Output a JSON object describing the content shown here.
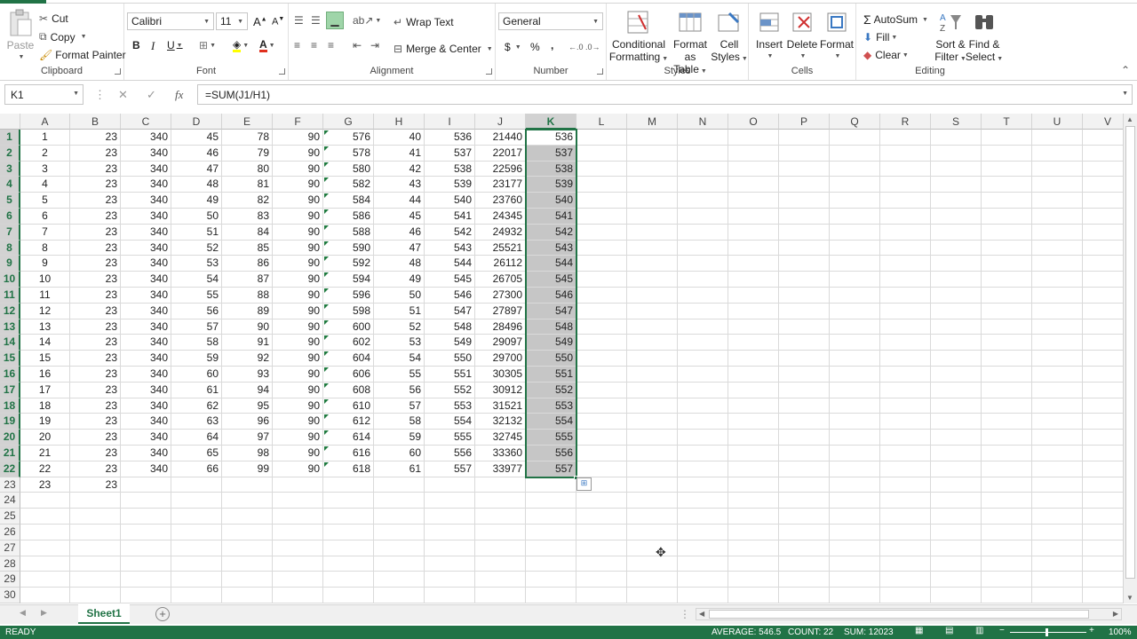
{
  "clipboard": {
    "paste": "Paste",
    "cut": "Cut",
    "copy": "Copy",
    "format_painter": "Format Painter",
    "label": "Clipboard"
  },
  "font": {
    "name": "Calibri",
    "size": "11",
    "label": "Font",
    "bold": "B",
    "italic": "I",
    "underline": "U"
  },
  "alignment": {
    "wrap": "Wrap Text",
    "merge": "Merge & Center",
    "label": "Alignment"
  },
  "number": {
    "format": "General",
    "currency": "$",
    "percent": "%",
    "comma": ",",
    "label": "Number"
  },
  "styles": {
    "conditional_1": "Conditional",
    "conditional_2": "Formatting",
    "table_1": "Format as",
    "table_2": "Table",
    "cell_1": "Cell",
    "cell_2": "Styles",
    "label": "Styles"
  },
  "cells": {
    "insert": "Insert",
    "delete": "Delete",
    "format": "Format",
    "label": "Cells"
  },
  "editing": {
    "autosum": "AutoSum",
    "fill": "Fill",
    "clear": "Clear",
    "sort_1": "Sort &",
    "sort_2": "Filter",
    "find_1": "Find &",
    "find_2": "Select",
    "label": "Editing"
  },
  "formula_bar": {
    "name_box": "K1",
    "fx": "fx",
    "formula": "=SUM(J1/H1)"
  },
  "grid": {
    "columns": [
      "A",
      "B",
      "C",
      "D",
      "E",
      "F",
      "G",
      "H",
      "I",
      "J",
      "K",
      "L",
      "M",
      "N",
      "O",
      "P",
      "Q",
      "R",
      "S",
      "T",
      "U",
      "V"
    ],
    "selected_column": "K",
    "rows": [
      [
        "1",
        "23",
        "340",
        "45",
        "78",
        "90",
        "576",
        "40",
        "536",
        "21440",
        "536"
      ],
      [
        "2",
        "23",
        "340",
        "46",
        "79",
        "90",
        "578",
        "41",
        "537",
        "22017",
        "537"
      ],
      [
        "3",
        "23",
        "340",
        "47",
        "80",
        "90",
        "580",
        "42",
        "538",
        "22596",
        "538"
      ],
      [
        "4",
        "23",
        "340",
        "48",
        "81",
        "90",
        "582",
        "43",
        "539",
        "23177",
        "539"
      ],
      [
        "5",
        "23",
        "340",
        "49",
        "82",
        "90",
        "584",
        "44",
        "540",
        "23760",
        "540"
      ],
      [
        "6",
        "23",
        "340",
        "50",
        "83",
        "90",
        "586",
        "45",
        "541",
        "24345",
        "541"
      ],
      [
        "7",
        "23",
        "340",
        "51",
        "84",
        "90",
        "588",
        "46",
        "542",
        "24932",
        "542"
      ],
      [
        "8",
        "23",
        "340",
        "52",
        "85",
        "90",
        "590",
        "47",
        "543",
        "25521",
        "543"
      ],
      [
        "9",
        "23",
        "340",
        "53",
        "86",
        "90",
        "592",
        "48",
        "544",
        "26112",
        "544"
      ],
      [
        "10",
        "23",
        "340",
        "54",
        "87",
        "90",
        "594",
        "49",
        "545",
        "26705",
        "545"
      ],
      [
        "11",
        "23",
        "340",
        "55",
        "88",
        "90",
        "596",
        "50",
        "546",
        "27300",
        "546"
      ],
      [
        "12",
        "23",
        "340",
        "56",
        "89",
        "90",
        "598",
        "51",
        "547",
        "27897",
        "547"
      ],
      [
        "13",
        "23",
        "340",
        "57",
        "90",
        "90",
        "600",
        "52",
        "548",
        "28496",
        "548"
      ],
      [
        "14",
        "23",
        "340",
        "58",
        "91",
        "90",
        "602",
        "53",
        "549",
        "29097",
        "549"
      ],
      [
        "15",
        "23",
        "340",
        "59",
        "92",
        "90",
        "604",
        "54",
        "550",
        "29700",
        "550"
      ],
      [
        "16",
        "23",
        "340",
        "60",
        "93",
        "90",
        "606",
        "55",
        "551",
        "30305",
        "551"
      ],
      [
        "17",
        "23",
        "340",
        "61",
        "94",
        "90",
        "608",
        "56",
        "552",
        "30912",
        "552"
      ],
      [
        "18",
        "23",
        "340",
        "62",
        "95",
        "90",
        "610",
        "57",
        "553",
        "31521",
        "553"
      ],
      [
        "19",
        "23",
        "340",
        "63",
        "96",
        "90",
        "612",
        "58",
        "554",
        "32132",
        "554"
      ],
      [
        "20",
        "23",
        "340",
        "64",
        "97",
        "90",
        "614",
        "59",
        "555",
        "32745",
        "555"
      ],
      [
        "21",
        "23",
        "340",
        "65",
        "98",
        "90",
        "616",
        "60",
        "556",
        "33360",
        "556"
      ],
      [
        "22",
        "23",
        "340",
        "66",
        "99",
        "90",
        "618",
        "61",
        "557",
        "33977",
        "557"
      ],
      [
        "23",
        "23",
        "",
        "",
        "",
        "",
        "",
        "",
        "",
        "",
        ""
      ],
      [
        "",
        "",
        "",
        "",
        "",
        "",
        "",
        "",
        "",
        "",
        ""
      ],
      [
        "",
        "",
        "",
        "",
        "",
        "",
        "",
        "",
        "",
        "",
        ""
      ],
      [
        "",
        "",
        "",
        "",
        "",
        "",
        "",
        "",
        "",
        "",
        ""
      ],
      [
        "",
        "",
        "",
        "",
        "",
        "",
        "",
        "",
        "",
        "",
        ""
      ],
      [
        "",
        "",
        "",
        "",
        "",
        "",
        "",
        "",
        "",
        "",
        ""
      ],
      [
        "",
        "",
        "",
        "",
        "",
        "",
        "",
        "",
        "",
        "",
        ""
      ],
      [
        "",
        "",
        "",
        "",
        "",
        "",
        "",
        "",
        "",
        "",
        ""
      ]
    ]
  },
  "sheet_tab": "Sheet1",
  "status": {
    "ready": "READY",
    "average": "AVERAGE: 546.5",
    "count": "COUNT: 22",
    "sum": "SUM: 12023",
    "zoom": "100%"
  },
  "colors": {
    "accent": "#217346",
    "selection": "#c6c6c6"
  }
}
